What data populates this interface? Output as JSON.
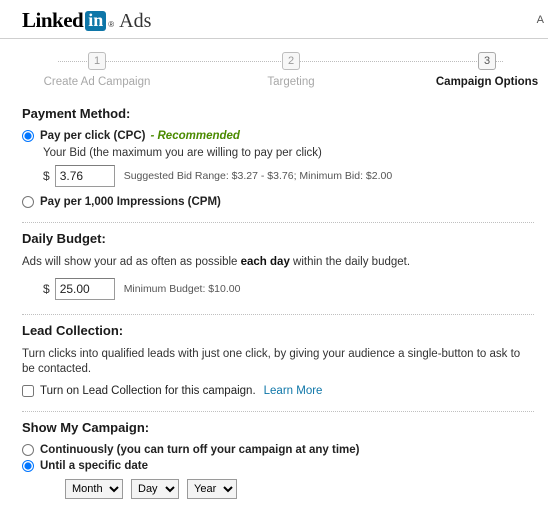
{
  "header": {
    "logo_linked": "Linked",
    "logo_in": "in",
    "logo_reg": "®",
    "logo_ads": "Ads",
    "right_text": "A"
  },
  "steps": [
    {
      "num": "1",
      "label": "Create Ad Campaign",
      "active": false
    },
    {
      "num": "2",
      "label": "Targeting",
      "active": false
    },
    {
      "num": "3",
      "label": "Campaign Options",
      "active": true
    }
  ],
  "payment": {
    "title": "Payment Method:",
    "cpc_label": "Pay per click (CPC)",
    "recommended": "- Recommended",
    "bid_help": "Your Bid (the maximum you are willing to pay per click)",
    "dollar": "$",
    "bid_value": "3.76",
    "bid_hint": "Suggested Bid Range: $3.27 - $3.76; Minimum Bid: $2.00",
    "cpm_label": "Pay per 1,000 Impressions (CPM)"
  },
  "daily_budget": {
    "title": "Daily Budget:",
    "description_pre": "Ads will show your ad as often as possible ",
    "description_bold": "each day",
    "description_post": " within the daily budget.",
    "dollar": "$",
    "budget_value": "25.00",
    "budget_hint": "Minimum Budget: $10.00"
  },
  "lead_collection": {
    "title": "Lead Collection:",
    "description": "Turn clicks into qualified leads with just one click, by giving your audience a single-button to ask to be contacted.",
    "checkbox_label": "Turn on Lead Collection for this campaign.",
    "learn_more": "Learn More"
  },
  "show_campaign": {
    "title": "Show My Campaign:",
    "continuous_label": "Continuously (you can turn off your campaign at any time)",
    "until_label": "Until a specific date",
    "month_selected": "Month",
    "day_selected": "Day",
    "year_selected": "Year",
    "month_options": [
      "Month"
    ],
    "day_options": [
      "Day"
    ],
    "year_options": [
      "Year"
    ]
  },
  "colors": {
    "brand_blue": "#0e76a8",
    "recommended_green": "#4b8b00",
    "link_blue": "#0e76a8"
  }
}
